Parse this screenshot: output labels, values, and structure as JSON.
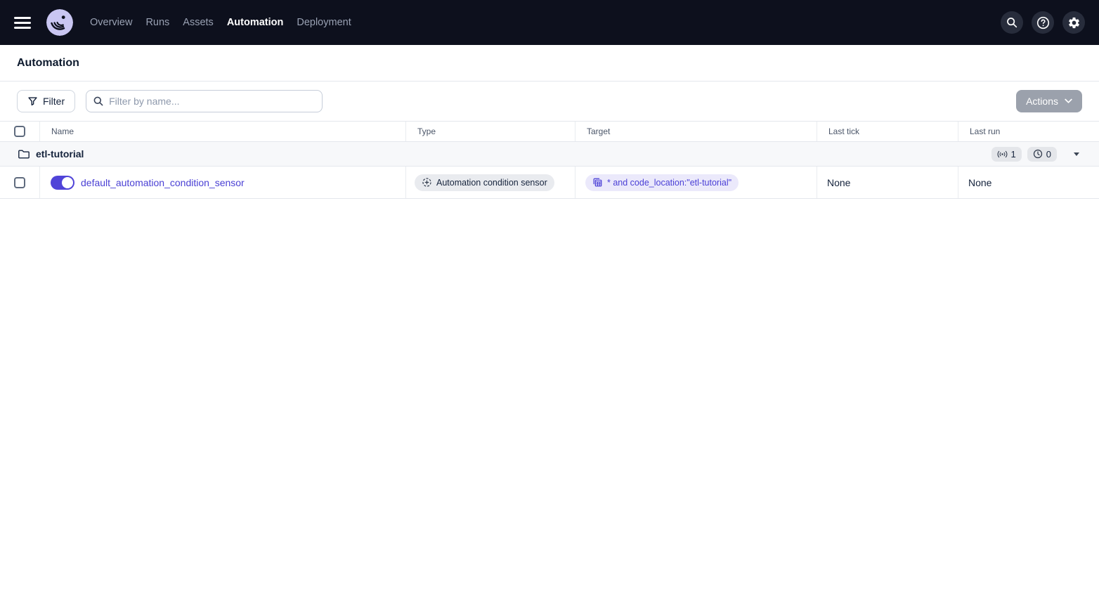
{
  "navbar": {
    "items": [
      {
        "label": "Overview",
        "active": false
      },
      {
        "label": "Runs",
        "active": false
      },
      {
        "label": "Assets",
        "active": false
      },
      {
        "label": "Automation",
        "active": true
      },
      {
        "label": "Deployment",
        "active": false
      }
    ],
    "icons": {
      "search": "search-icon",
      "help": "help-icon",
      "settings": "gear-icon"
    }
  },
  "page": {
    "title": "Automation"
  },
  "toolbar": {
    "filter_button": "Filter",
    "search_placeholder": "Filter by name...",
    "actions_button": "Actions"
  },
  "table": {
    "headers": {
      "name": "Name",
      "type": "Type",
      "target": "Target",
      "last_tick": "Last tick",
      "last_run": "Last run"
    },
    "group": {
      "name": "etl-tutorial",
      "sensor_count": "1",
      "schedule_count": "0"
    },
    "rows": [
      {
        "name": "default_automation_condition_sensor",
        "enabled": true,
        "type_label": "Automation condition sensor",
        "target_label": "* and code_location:\"etl-tutorial\"",
        "last_tick": "None",
        "last_run": "None"
      }
    ]
  },
  "colors": {
    "navbar_bg": "#0d101d",
    "accent_blurple": "#5044d8",
    "link": "#4a40d4",
    "target_badge_bg": "#ebe9fb",
    "type_badge_bg": "#e9ebef",
    "group_row_bg": "#f7f8fa",
    "border": "#e4e7ed",
    "disabled_button_bg": "#9ba1ac"
  }
}
